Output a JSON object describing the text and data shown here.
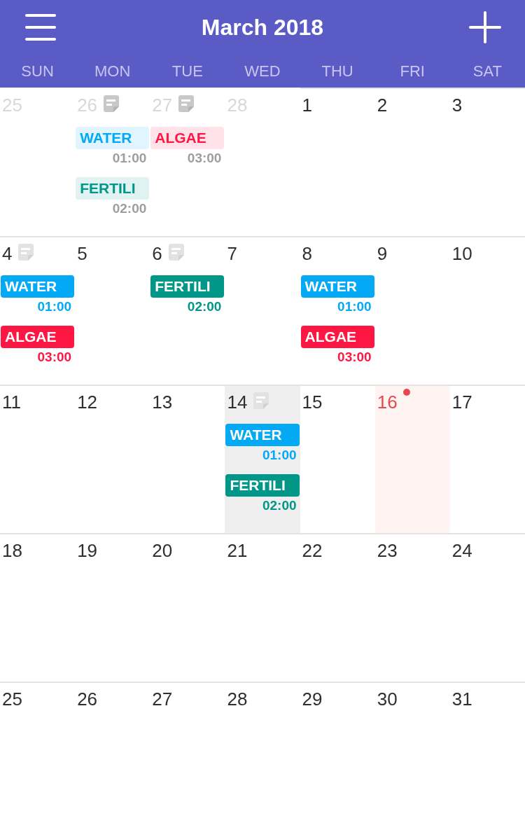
{
  "header": {
    "title": "March 2018"
  },
  "weekdays": [
    "SUN",
    "MON",
    "TUE",
    "WED",
    "THU",
    "FRI",
    "SAT"
  ],
  "weeks": [
    {
      "days": [
        {
          "number": "25",
          "in_month": false,
          "selected": false,
          "today": false,
          "has_note": false
        },
        {
          "number": "26",
          "in_month": false,
          "selected": false,
          "today": false,
          "has_note": true,
          "events": [
            {
              "title": "WATER",
              "time": "01:00",
              "color": "#03a9f4"
            },
            {
              "title": "FERTILI",
              "time": "02:00",
              "color": "#009688"
            }
          ]
        },
        {
          "number": "27",
          "in_month": false,
          "selected": false,
          "today": false,
          "has_note": true,
          "events": [
            {
              "title": "ALGAE",
              "time": "03:00",
              "color": "#ff1744"
            }
          ]
        },
        {
          "number": "28",
          "in_month": false,
          "selected": false,
          "today": false,
          "has_note": false
        },
        {
          "number": "1",
          "in_month": true,
          "selected": false,
          "today": false,
          "has_note": false
        },
        {
          "number": "2",
          "in_month": true,
          "selected": false,
          "today": false,
          "has_note": false
        },
        {
          "number": "3",
          "in_month": true,
          "selected": false,
          "today": false,
          "has_note": false
        }
      ]
    },
    {
      "days": [
        {
          "number": "4",
          "in_month": true,
          "selected": false,
          "today": false,
          "has_note": true,
          "events": [
            {
              "title": "WATER",
              "time": "01:00",
              "color": "#03a9f4"
            },
            {
              "title": "ALGAE",
              "time": "03:00",
              "color": "#ff1744"
            }
          ]
        },
        {
          "number": "5",
          "in_month": true,
          "selected": false,
          "today": false,
          "has_note": false
        },
        {
          "number": "6",
          "in_month": true,
          "selected": false,
          "today": false,
          "has_note": true,
          "events": [
            {
              "title": "FERTILI",
              "time": "02:00",
              "color": "#009688"
            }
          ]
        },
        {
          "number": "7",
          "in_month": true,
          "selected": false,
          "today": false,
          "has_note": false
        },
        {
          "number": "8",
          "in_month": true,
          "selected": false,
          "today": false,
          "has_note": false,
          "events": [
            {
              "title": "WATER",
              "time": "01:00",
              "color": "#03a9f4"
            },
            {
              "title": "ALGAE",
              "time": "03:00",
              "color": "#ff1744"
            }
          ]
        },
        {
          "number": "9",
          "in_month": true,
          "selected": false,
          "today": false,
          "has_note": false
        },
        {
          "number": "10",
          "in_month": true,
          "selected": false,
          "today": false,
          "has_note": false
        }
      ]
    },
    {
      "days": [
        {
          "number": "11",
          "in_month": true,
          "selected": false,
          "today": false,
          "has_note": false
        },
        {
          "number": "12",
          "in_month": true,
          "selected": false,
          "today": false,
          "has_note": false
        },
        {
          "number": "13",
          "in_month": true,
          "selected": false,
          "today": false,
          "has_note": false
        },
        {
          "number": "14",
          "in_month": true,
          "selected": true,
          "today": false,
          "has_note": true,
          "events": [
            {
              "title": "WATER",
              "time": "01:00",
              "color": "#03a9f4"
            },
            {
              "title": "FERTILI",
              "time": "02:00",
              "color": "#009688"
            }
          ]
        },
        {
          "number": "15",
          "in_month": true,
          "selected": false,
          "today": false,
          "has_note": false
        },
        {
          "number": "16",
          "in_month": true,
          "selected": false,
          "today": true,
          "has_note": false
        },
        {
          "number": "17",
          "in_month": true,
          "selected": false,
          "today": false,
          "has_note": false
        }
      ]
    },
    {
      "days": [
        {
          "number": "18",
          "in_month": true,
          "selected": false,
          "today": false,
          "has_note": false
        },
        {
          "number": "19",
          "in_month": true,
          "selected": false,
          "today": false,
          "has_note": false
        },
        {
          "number": "20",
          "in_month": true,
          "selected": false,
          "today": false,
          "has_note": false
        },
        {
          "number": "21",
          "in_month": true,
          "selected": false,
          "today": false,
          "has_note": false
        },
        {
          "number": "22",
          "in_month": true,
          "selected": false,
          "today": false,
          "has_note": false
        },
        {
          "number": "23",
          "in_month": true,
          "selected": false,
          "today": false,
          "has_note": false
        },
        {
          "number": "24",
          "in_month": true,
          "selected": false,
          "today": false,
          "has_note": false
        }
      ]
    },
    {
      "days": [
        {
          "number": "25",
          "in_month": true,
          "selected": false,
          "today": false,
          "has_note": false
        },
        {
          "number": "26",
          "in_month": true,
          "selected": false,
          "today": false,
          "has_note": false
        },
        {
          "number": "27",
          "in_month": true,
          "selected": false,
          "today": false,
          "has_note": false
        },
        {
          "number": "28",
          "in_month": true,
          "selected": false,
          "today": false,
          "has_note": false
        },
        {
          "number": "29",
          "in_month": true,
          "selected": false,
          "today": false,
          "has_note": false
        },
        {
          "number": "30",
          "in_month": true,
          "selected": false,
          "today": false,
          "has_note": false
        },
        {
          "number": "31",
          "in_month": true,
          "selected": false,
          "today": false,
          "has_note": false
        }
      ]
    }
  ]
}
